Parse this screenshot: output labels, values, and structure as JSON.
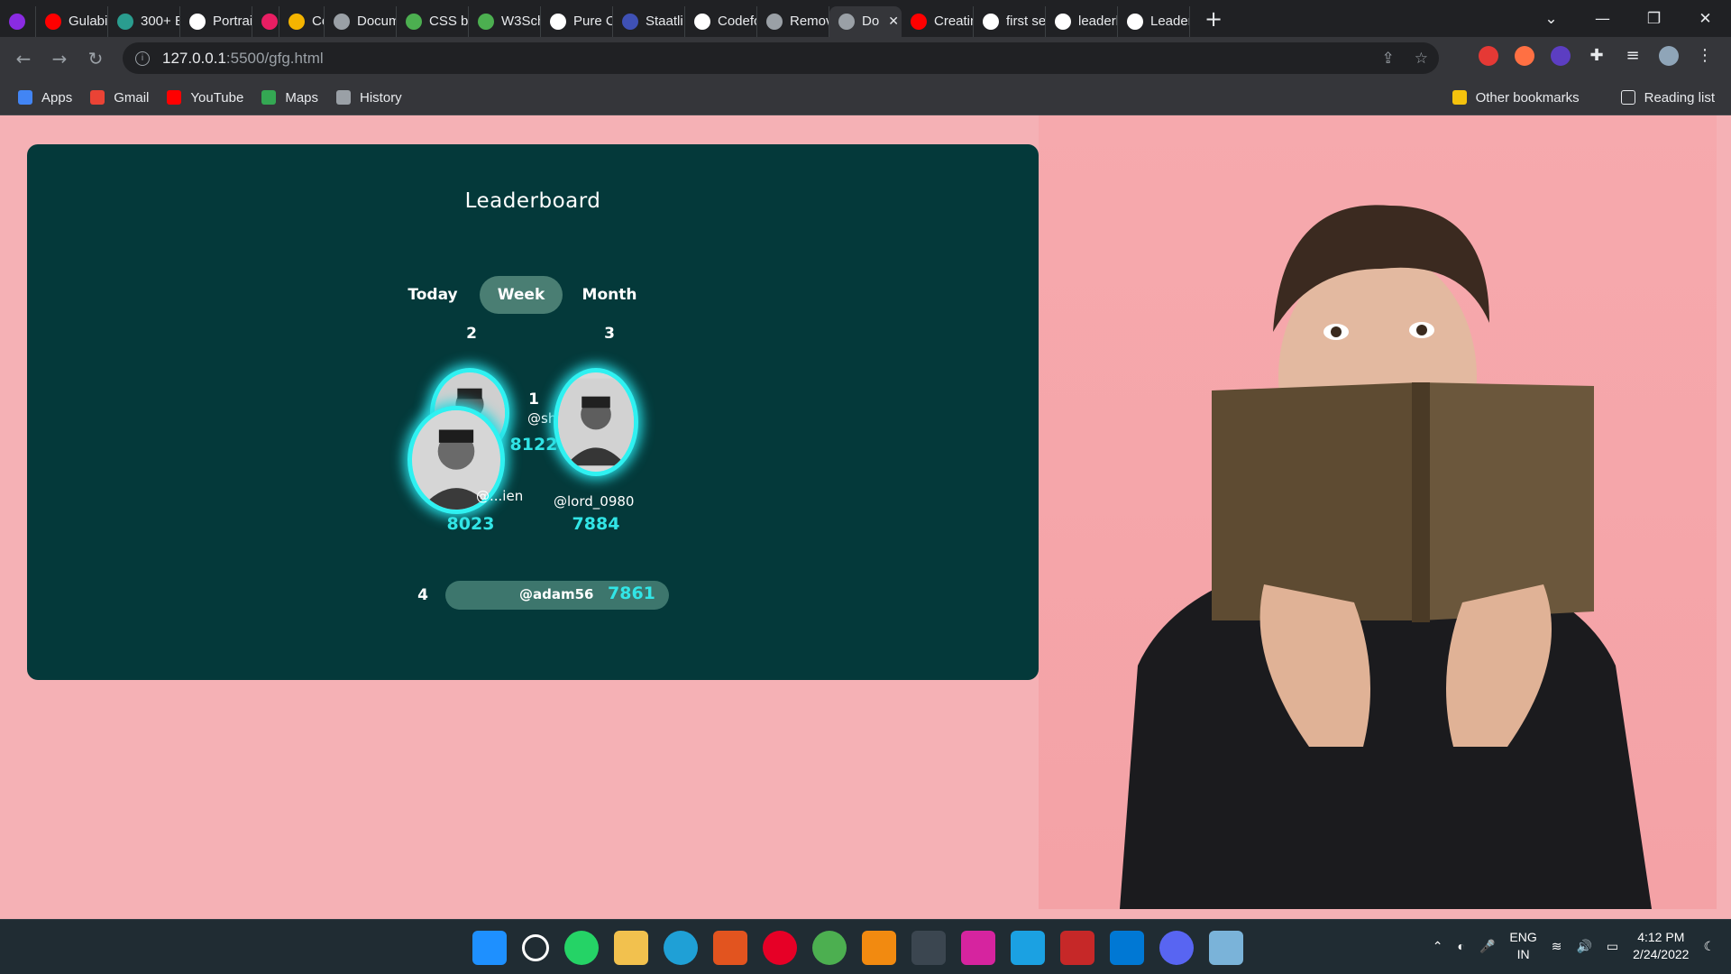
{
  "browser": {
    "tabs": [
      {
        "label": "",
        "color": "#8a2be2"
      },
      {
        "label": "Gulabi",
        "color": "#ff0000"
      },
      {
        "label": "300+ E",
        "color": "#2a9d8f"
      },
      {
        "label": "Portrai",
        "color": "#ffffff"
      },
      {
        "label": "",
        "color": "#e91e63"
      },
      {
        "label": "Co",
        "color": "#f4b400"
      },
      {
        "label": "Docum",
        "color": "#9aa0a6"
      },
      {
        "label": "CSS ba",
        "color": "#4caf50"
      },
      {
        "label": "W3Sch",
        "color": "#4caf50"
      },
      {
        "label": "Pure C",
        "color": "#ffffff"
      },
      {
        "label": "Staatli",
        "color": "#3f51b5"
      },
      {
        "label": "Codefc",
        "color": "#ffffff"
      },
      {
        "label": "Remov",
        "color": "#9aa0a6"
      },
      {
        "label": "Do",
        "color": "#9aa0a6",
        "active": true
      },
      {
        "label": "Creatin",
        "color": "#ff0000"
      },
      {
        "label": "first se",
        "color": "#ffffff"
      },
      {
        "label": "leaderl",
        "color": "#ffffff"
      },
      {
        "label": "Leader",
        "color": "#ffffff"
      }
    ],
    "url_host": "127.0.0.1",
    "url_path": ":5500/gfg.html",
    "bookmarks": [
      {
        "label": "Apps",
        "color": "#4285f4"
      },
      {
        "label": "Gmail",
        "color": "#ea4335"
      },
      {
        "label": "YouTube",
        "color": "#ff0000"
      },
      {
        "label": "Maps",
        "color": "#34a853"
      },
      {
        "label": "History",
        "color": "#9aa0a6"
      }
    ],
    "other_bookmarks": "Other bookmarks",
    "reading_list": "Reading list"
  },
  "leaderboard": {
    "title": "Leaderboard",
    "filters": [
      "Today",
      "Week",
      "Month"
    ],
    "active_filter": "Week",
    "podium": [
      {
        "rank": "2",
        "username": "@...ien",
        "score": "8023"
      },
      {
        "rank": "1",
        "username": "@sher234",
        "score": "8122"
      },
      {
        "rank": "3",
        "username": "@lord_0980",
        "score": "7884"
      }
    ],
    "list": [
      {
        "rank": "4",
        "username": "@adam56",
        "score": "7861"
      }
    ]
  },
  "colors": {
    "page_bg": "#f5b1b5",
    "card_bg": "#04393a",
    "accent": "#32e5e6",
    "active_tab": "#4a7e73"
  },
  "taskbar": {
    "language": "ENG",
    "region": "IN",
    "time": "4:12 PM",
    "date": "2/24/2022"
  }
}
